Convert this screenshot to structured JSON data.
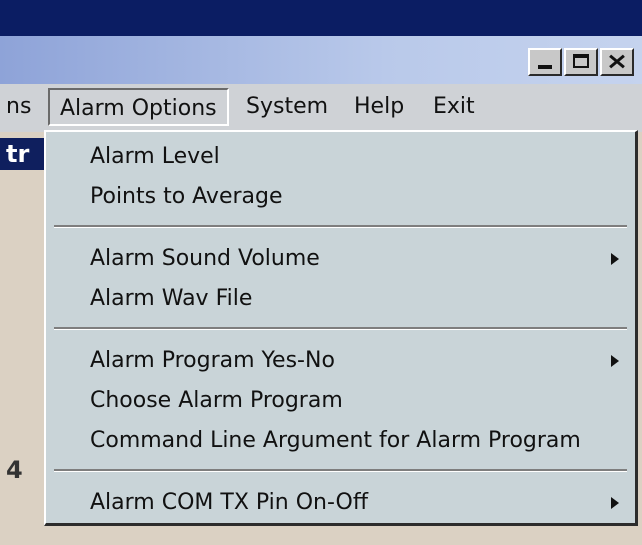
{
  "menubar": {
    "items": [
      {
        "label": "ns"
      },
      {
        "label": "Alarm Options"
      },
      {
        "label": "System"
      },
      {
        "label": "Help"
      },
      {
        "label": "Exit"
      }
    ]
  },
  "background": {
    "dark_label": "tr",
    "left_char": "4"
  },
  "dropdown": {
    "items": [
      {
        "label": "Alarm Level"
      },
      {
        "label": "Points to Average"
      },
      {
        "label": "Alarm Sound Volume"
      },
      {
        "label": "Alarm Wav File"
      },
      {
        "label": "Alarm Program Yes-No"
      },
      {
        "label": "Choose Alarm Program"
      },
      {
        "label": "Command Line Argument for Alarm Program"
      },
      {
        "label": "Alarm COM TX Pin On-Off"
      }
    ]
  }
}
